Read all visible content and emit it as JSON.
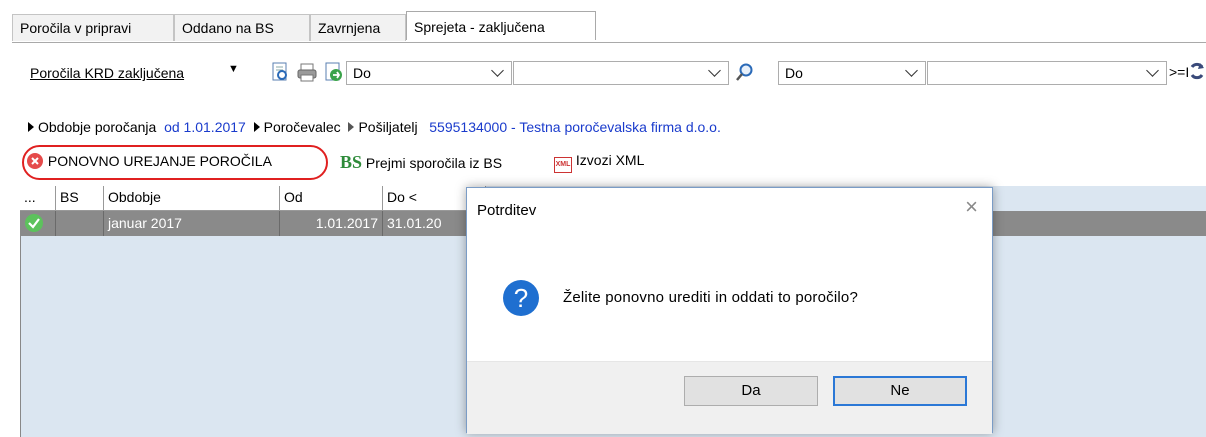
{
  "tabs": [
    {
      "label": "Poročila v pripravi"
    },
    {
      "label": "Oddano na BS"
    },
    {
      "label": "Zavrnjena"
    },
    {
      "label": "Sprejeta - zaključena",
      "active": true
    }
  ],
  "toolbar": {
    "report_menu": "Poročila KRD zaključena",
    "filter1_op": "Do",
    "filter1_value": "",
    "filter2_op": "Do",
    "filter2_value": "",
    "trailing": ">=I"
  },
  "info": {
    "period_label": "Obdobje poročanja",
    "period_value": "od 1.01.2017",
    "reporter_label": "Poročevalec",
    "sender_label": "Pošiljatelj",
    "sender_value": "5595134000 - Testna poročevalska firma d.o.o."
  },
  "actions": {
    "reedit": "PONOVNO UREJANJE POROČILA",
    "bs_badge": "BS",
    "receive": "Prejmi sporočila iz BS",
    "xml_badge": "XML",
    "export": "Izvozi XML"
  },
  "grid": {
    "columns": [
      "...",
      "BS",
      "Obdobje",
      "Od",
      "Do <"
    ],
    "rows": [
      {
        "status": "ok",
        "bs": "",
        "obdobje": "januar 2017",
        "od": "1.01.2017",
        "do": "31.01.20"
      }
    ]
  },
  "dialog": {
    "title": "Potrditev",
    "close": "×",
    "icon": "?",
    "message": "Želite ponovno urediti in oddati to poročilo?",
    "yes": "Da",
    "no": "Ne"
  },
  "colors": {
    "accent": "#2b78d6",
    "link": "#1a3bcc",
    "highlight_ring": "#e02020",
    "selected_row": "#8a8a8a",
    "grid_bg": "#dbe6f1"
  }
}
